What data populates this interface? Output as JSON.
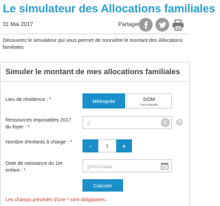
{
  "header": {
    "title": "Le simulateur des Allocations familiales",
    "date": "31 Mai 2017",
    "share_label": "Partager"
  },
  "intro_text": "Découvrez le simulateur qui vous permet de connaître le montant des Allocations familiales",
  "form": {
    "title": "Simuler le montant de mes allocations familiales",
    "residence": {
      "label": "Lieu de résidence : *",
      "options": [
        {
          "label": "Métropole",
          "sub": "",
          "selected": true
        },
        {
          "label": "DOM",
          "sub": "hors Mayotte",
          "selected": false
        }
      ]
    },
    "income": {
      "label": "Ressources imposables 2017 du foyer : *",
      "value": "0",
      "currency": "€",
      "help": "?"
    },
    "children": {
      "label": "Nombre d'enfants à charge : *",
      "minus": "-",
      "value": "1",
      "plus": "+"
    },
    "birthdate": {
      "label": "Date de naissance du 1er enfant : *",
      "placeholder": "jj/mm/aaaa"
    },
    "submit_label": "Calculer",
    "required_note": "Les champs précédés d'une * sont obligatoires."
  },
  "icons": {
    "facebook": "facebook-icon",
    "twitter": "twitter-icon",
    "print": "print-icon",
    "calendar": "calendar-icon"
  },
  "colors": {
    "title": "#2a9fd0",
    "primary_button": "#1a8fc9",
    "share_icon_bg": "#9b9b9b",
    "required_note": "#d03a2a"
  }
}
